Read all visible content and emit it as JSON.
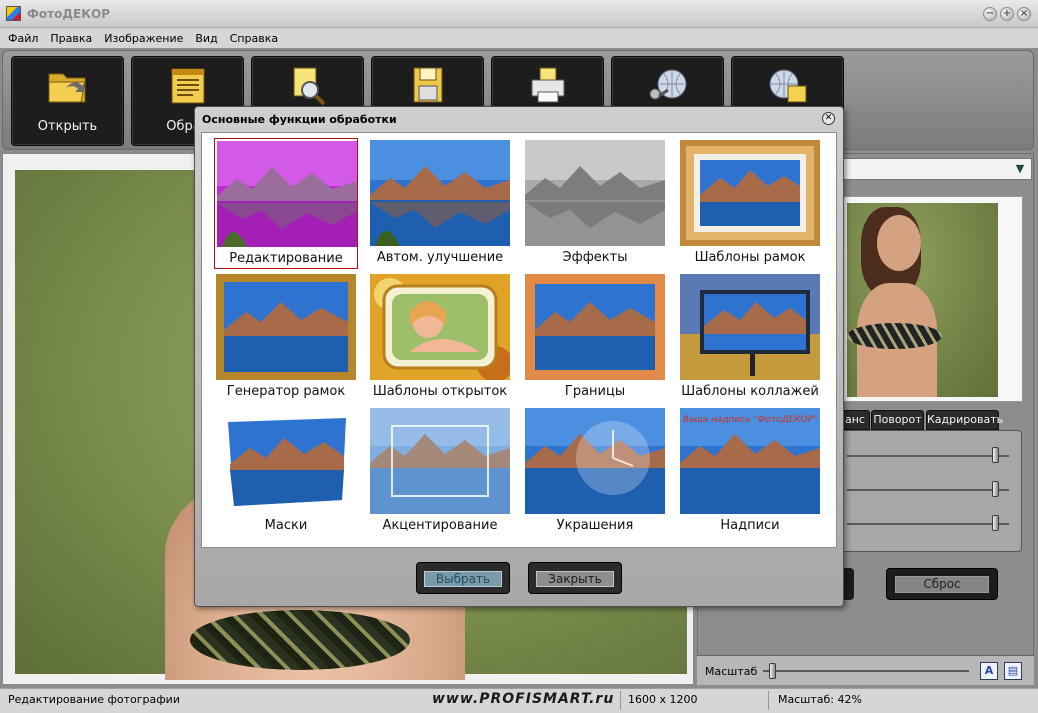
{
  "window": {
    "title": "ФотоДЕКОР"
  },
  "menu": [
    "Файл",
    "Правка",
    "Изображение",
    "Вид",
    "Справка"
  ],
  "toolbar": {
    "buttons": [
      {
        "label": "Открыть",
        "icon": "folder-open-icon"
      },
      {
        "label": "Обраб",
        "icon": "document-list-icon"
      },
      {
        "label": "",
        "icon": "search-document-icon"
      },
      {
        "label": "",
        "icon": "save-disk-icon"
      },
      {
        "label": "",
        "icon": "print-icon"
      },
      {
        "label": "",
        "icon": "globe-key-icon"
      },
      {
        "label": "",
        "icon": "globe-web-icon"
      }
    ]
  },
  "right_panel": {
    "tabs": [
      "анс",
      "Поворот",
      "Кадрировать"
    ],
    "slider_levels": [
      0.92,
      0.92,
      0.92
    ],
    "reset_label": "Сброс",
    "zoom_label": "Масштаб",
    "zoom_level": 0.05
  },
  "dialog": {
    "title": "Основные функции обработки",
    "items": [
      {
        "label": "Редактирование",
        "selected": true
      },
      {
        "label": "Автом. улучшение",
        "selected": false
      },
      {
        "label": "Эффекты",
        "selected": false
      },
      {
        "label": "Шаблоны рамок",
        "selected": false
      },
      {
        "label": "Генератор рамок",
        "selected": false
      },
      {
        "label": "Шаблоны открыток",
        "selected": false
      },
      {
        "label": "Границы",
        "selected": false
      },
      {
        "label": "Шаблоны коллажей",
        "selected": false
      },
      {
        "label": "Маски",
        "selected": false
      },
      {
        "label": "Акцентирование",
        "selected": false
      },
      {
        "label": "Украшения",
        "selected": false
      },
      {
        "label": "Надписи",
        "selected": false
      }
    ],
    "ok_label": "Выбрать",
    "close_label": "Закрыть",
    "overlay_text": "Ваша надпись \"ФотоДЕКОР\""
  },
  "status": {
    "left": "Редактирование фотографии",
    "watermark": "www.PROFISMART.ru",
    "resolution": "1600 x 1200",
    "zoom": "Масштаб: 42%"
  },
  "colors": {
    "accent_selected": "#b10f14",
    "toolbar_button": "#1d1d1d",
    "workspace_bg": "#7f9451"
  }
}
